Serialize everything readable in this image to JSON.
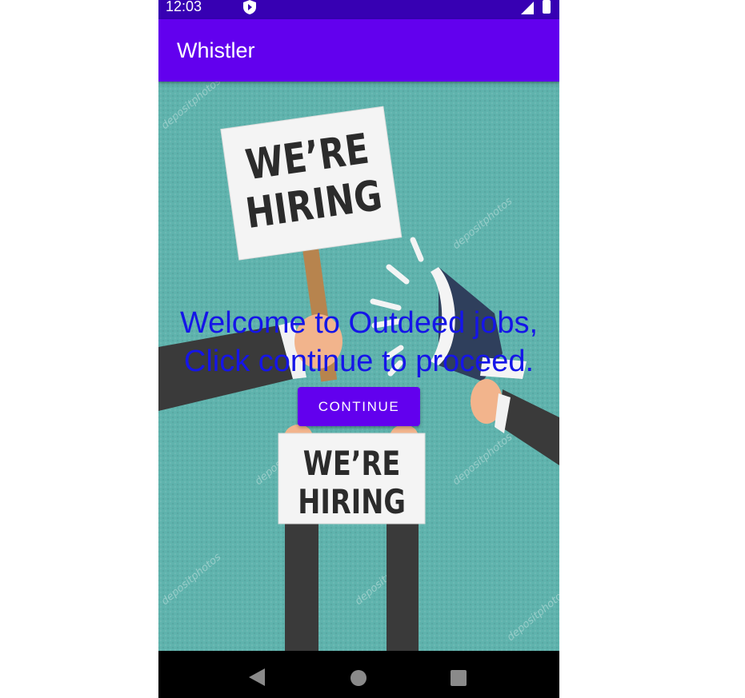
{
  "status_bar": {
    "time": "12:03"
  },
  "app_bar": {
    "title": "Whistler"
  },
  "main": {
    "welcome_line1": "Welcome to Outdeed jobs,",
    "welcome_line2": "Click continue to proceed.",
    "continue_label": "CONTINUE",
    "sign_top_line1": "WE’RE",
    "sign_top_line2": "HIRING",
    "sign_bottom_line1": "WE’RE",
    "sign_bottom_line2": "HIRING",
    "watermark": "depositphotos"
  },
  "colors": {
    "status_bar": "#3700b3",
    "app_bar": "#6200ee",
    "button": "#6200ee",
    "welcome_text": "#1515e8",
    "background": "#5fb3ad"
  },
  "icons": [
    "app-shield-icon",
    "signal-icon",
    "battery-icon",
    "back-icon",
    "home-icon",
    "recents-icon"
  ]
}
